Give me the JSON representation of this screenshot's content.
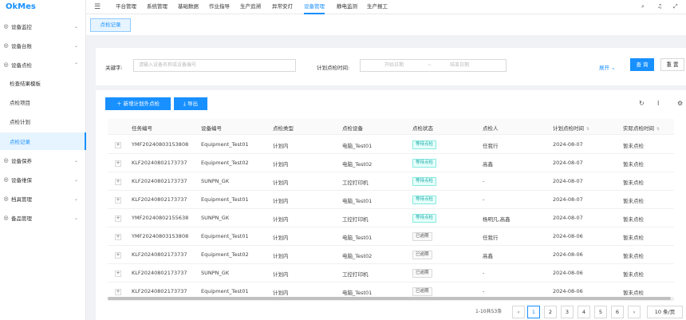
{
  "app": {
    "logo": "OkMes"
  },
  "sidebar": {
    "items": [
      {
        "label": "设备监控",
        "icon": "monitor-icon",
        "chev": "⌄"
      },
      {
        "label": "设备台账",
        "icon": "ledger-icon",
        "chev": "⌄"
      },
      {
        "label": "设备点检",
        "icon": "inspect-icon",
        "chev": "⌃"
      },
      {
        "label": "检查结果模板"
      },
      {
        "label": "点检项目"
      },
      {
        "label": "点检计划"
      },
      {
        "label": "点检记录"
      },
      {
        "label": "设备保养",
        "icon": "maintain-icon",
        "chev": "⌄"
      },
      {
        "label": "设备维保",
        "icon": "repair-icon",
        "chev": "⌄"
      },
      {
        "label": "档具管理",
        "icon": "tool-icon",
        "chev": "⌄"
      },
      {
        "label": "备品管理",
        "icon": "spare-icon",
        "chev": "⌄"
      }
    ]
  },
  "topnav": {
    "items": [
      "平台管理",
      "系统管理",
      "基础数据",
      "作业指导",
      "生产追溯",
      "异常安灯",
      "设备管理",
      "静电监测",
      "生产报工"
    ],
    "active_index": 6
  },
  "tabs": {
    "active": "点检记录"
  },
  "search": {
    "keyword_label": "关键字:",
    "keyword_placeholder": "请输入设备名称或设备编号",
    "date_label": "计划点检时间:",
    "start_placeholder": "开始日期",
    "date_sep": "~",
    "end_placeholder": "结束日期",
    "expand_label": "展开",
    "query_label": "查 询",
    "reset_label": "重 置"
  },
  "toolbar": {
    "add_label": "新增计划外点检",
    "export_label": "导出"
  },
  "table": {
    "columns": [
      "任务编号",
      "设备编号",
      "点检类型",
      "点检设备",
      "点检状态",
      "点检人",
      "计划点检时间",
      "实际点检时间"
    ],
    "rows": [
      [
        "YMF20240803153808",
        "Equipment_Test01",
        "计划内",
        "电脑_Test01",
        "等待点检",
        "任我行",
        "2024-08-07",
        "暂未点检"
      ],
      [
        "KLF20240802173737",
        "Equipment_Test02",
        "计划内",
        "电脑_Test02",
        "等待点检",
        "高鑫",
        "2024-08-07",
        "暂未点检"
      ],
      [
        "KLF20240802173737",
        "SUNPN_GK",
        "计划内",
        "工控打印机",
        "等待点检",
        "-",
        "2024-08-07",
        "暂未点检"
      ],
      [
        "KLF20240802173737",
        "Equipment_Test01",
        "计划内",
        "电脑_Test01",
        "等待点检",
        "-",
        "2024-08-07",
        "暂未点检"
      ],
      [
        "YMF20240802155638",
        "SUNPN_GK",
        "计划内",
        "工控打印机",
        "等待点检",
        "杨明凡,高鑫",
        "2024-08-07",
        "暂未点检"
      ],
      [
        "YMF20240803153808",
        "Equipment_Test01",
        "计划内",
        "电脑_Test01",
        "已逾期",
        "任我行",
        "2024-08-06",
        "暂未点检"
      ],
      [
        "KLF20240802173737",
        "Equipment_Test02",
        "计划内",
        "电脑_Test02",
        "已逾期",
        "高鑫",
        "2024-08-06",
        "暂未点检"
      ],
      [
        "KLF20240802173737",
        "SUNPN_GK",
        "计划内",
        "工控打印机",
        "已逾期",
        "-",
        "2024-08-06",
        "暂未点检"
      ],
      [
        "KLF20240802173737",
        "Equipment_Test01",
        "计划内",
        "电脑_Test01",
        "已逾期",
        "-",
        "2024-08-06",
        "暂未点检"
      ]
    ]
  },
  "pagination": {
    "total_text": "1-10共53条",
    "prev": "‹",
    "pages": [
      "1",
      "2",
      "3",
      "4",
      "5",
      "6"
    ],
    "next": "›",
    "page_size": "10 条/页",
    "active_page": "1"
  },
  "colors": {
    "accent": "#1890ff",
    "wait_tag": "#13a8a8"
  }
}
